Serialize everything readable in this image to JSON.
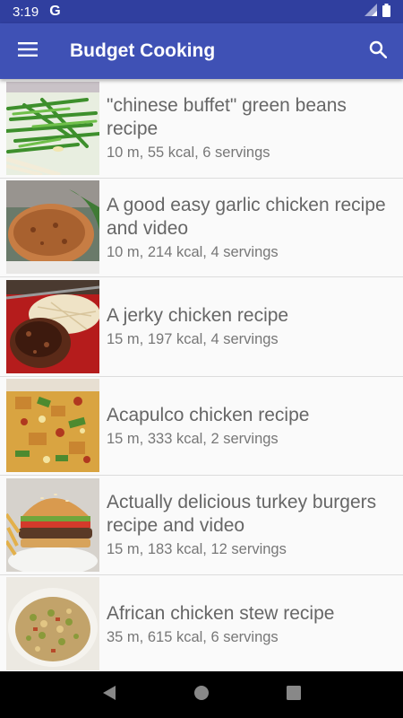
{
  "status": {
    "time": "3:19",
    "app_icon": "G"
  },
  "appbar": {
    "title": "Budget Cooking",
    "menu_icon": "hamburger-icon",
    "search_icon": "search-icon"
  },
  "recipes": [
    {
      "title": "\"chinese buffet\" green beans recipe",
      "meta": "10 m, 55 kcal, 6 servings"
    },
    {
      "title": "A good easy garlic chicken recipe and video",
      "meta": "10 m, 214 kcal, 4 servings"
    },
    {
      "title": "A jerky chicken recipe",
      "meta": "15 m, 197 kcal, 4 servings"
    },
    {
      "title": "Acapulco chicken recipe",
      "meta": "15 m, 333 kcal, 2 servings"
    },
    {
      "title": "Actually delicious turkey burgers recipe and video",
      "meta": "15 m, 183 kcal, 12 servings"
    },
    {
      "title": "African chicken stew recipe",
      "meta": "35 m, 615 kcal, 6 servings"
    }
  ],
  "colors": {
    "primary": "#3f51b5",
    "primary_dark": "#303f9f"
  }
}
